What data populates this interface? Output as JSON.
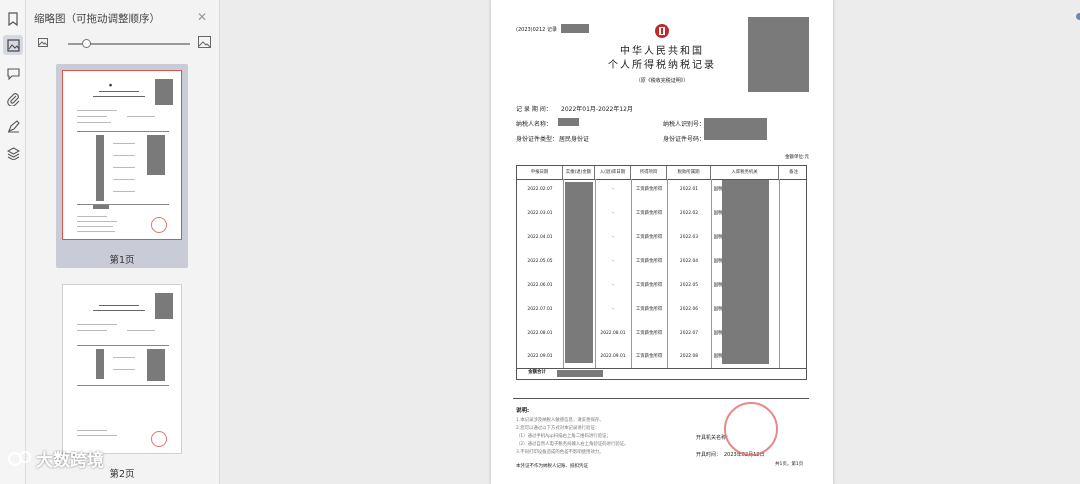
{
  "panel": {
    "title": "缩略图（可拖动调整顺序）",
    "close": "✕"
  },
  "thumbnails": [
    {
      "label": "第1页"
    },
    {
      "label": "第2页"
    }
  ],
  "doc": {
    "serial": "(2023)0212 记录",
    "title_line1": "中华人民共和国",
    "title_line2": "个人所得税纳税记录",
    "subtitle": "（原《税收完税证明》）",
    "period_label": "记 录 期 间：",
    "period_value": "2022年01月-2022年12月",
    "name_label": "纳税人名称：",
    "taxid_label": "纳税人识别号：",
    "idtype_label": "身份证件类型：",
    "idtype_value": "居民身份证",
    "idno_label": "身份证件号码：",
    "unit": "金额单位:元",
    "columns": [
      "申报日期",
      "实缴(退)金额",
      "入(退)库日期",
      "所得项目",
      "税款所属期",
      "入库税务机关",
      "备注"
    ],
    "rows": [
      {
        "date": "2022.02.07",
        "entry": "-",
        "item": "工资薪金所得",
        "period": "2022.01",
        "auth": "国税"
      },
      {
        "date": "2022.03.01",
        "entry": "-",
        "item": "工资薪金所得",
        "period": "2022.02",
        "auth": "国税"
      },
      {
        "date": "2022.04.01",
        "entry": "-",
        "item": "工资薪金所得",
        "period": "2022.03",
        "auth": "国税"
      },
      {
        "date": "2022.05.05",
        "entry": "-",
        "item": "工资薪金所得",
        "period": "2022.04",
        "auth": "国税"
      },
      {
        "date": "2022.06.01",
        "entry": "-",
        "item": "工资薪金所得",
        "period": "2022.05",
        "auth": "国税"
      },
      {
        "date": "2022.07.01",
        "entry": "-",
        "item": "工资薪金所得",
        "period": "2022.06",
        "auth": "国税"
      },
      {
        "date": "2022.08.01",
        "entry": "2022.08.01",
        "item": "工资薪金所得",
        "period": "2022.07",
        "auth": "国税"
      },
      {
        "date": "2022.09.01",
        "entry": "2022.09.01",
        "item": "工资薪金所得",
        "period": "2022.08",
        "auth": "国税"
      }
    ],
    "total_label": "金额合计",
    "notes_title": "说明:",
    "notes": [
      "1.本记录涉及纳税人敏感信息，请妥善保存。",
      "2.您可以通过以下方式对本记录进行验证：",
      "（1）通过手机App扫描右上角二维码进行验证；",
      "（2）通过自然人电子税务局输入右上角验证码进行验证。",
      "3.不同打印设备造成的色差不影响使用效力。"
    ],
    "issuer_label": "开具机关名称：",
    "issue_date_label": "开具时间：",
    "issue_date_value": "2023年02月12日",
    "footer_left": "本凭证不作为纳税人记账、抵扣凭证",
    "footer_right": "共1页，第1页"
  },
  "watermark": "大数跨境"
}
